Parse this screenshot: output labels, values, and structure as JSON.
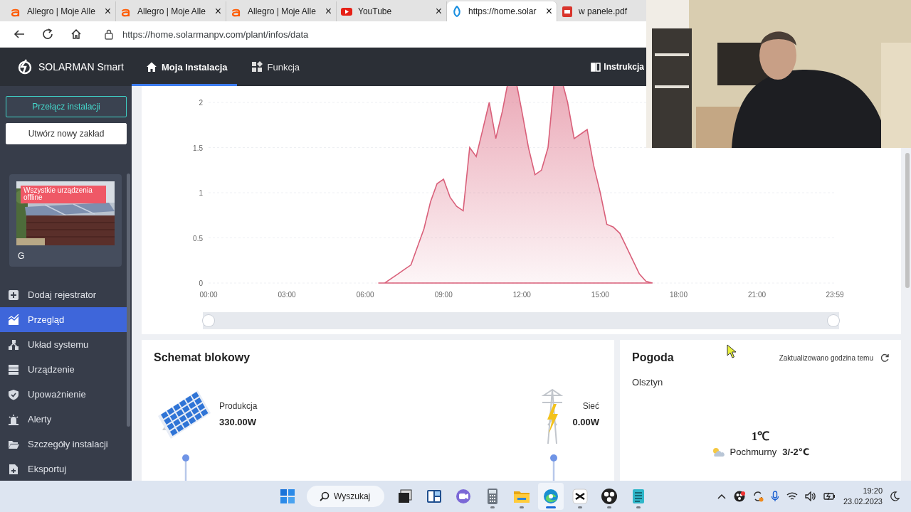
{
  "browser": {
    "tabs": [
      {
        "kind": "allegro",
        "title": "Allegro | Moje Alle",
        "close": "×",
        "selected": false
      },
      {
        "kind": "allegro",
        "title": "Allegro | Moje Alle",
        "close": "×",
        "selected": false
      },
      {
        "kind": "allegro",
        "title": "Allegro | Moje Alle",
        "close": "×",
        "selected": false
      },
      {
        "kind": "youtube",
        "title": "YouTube",
        "close": "×",
        "selected": false
      },
      {
        "kind": "solarman",
        "title": "https://home.solar",
        "close": "×",
        "selected": true
      },
      {
        "kind": "pdf",
        "title": "w panele.pdf",
        "selected": false
      }
    ],
    "url": "https://home.solarmanpv.com/plant/infos/data"
  },
  "app": {
    "logo_text": "SOLARMAN Smart",
    "nav": [
      {
        "kind": "home",
        "label": "Moja Instalacja",
        "selected": true
      },
      {
        "kind": "grid",
        "label": "Funkcja",
        "selected": false
      }
    ],
    "header_link": "Instrukcja"
  },
  "sidebar": {
    "buttons": [
      {
        "kind": "outline",
        "label": "Przełącz instalacji"
      },
      {
        "kind": "solid",
        "label": "Utwórz nowy zakład"
      }
    ],
    "plant": {
      "badge": "Wszystkie urządzenia offline",
      "name": "G"
    },
    "items": [
      {
        "kind": "plus",
        "label": "Dodaj rejestrator",
        "selected": false
      },
      {
        "kind": "chart",
        "label": "Przegląd",
        "selected": true
      },
      {
        "kind": "network",
        "label": "Układ systemu",
        "selected": false
      },
      {
        "kind": "server",
        "label": "Urządzenie",
        "selected": false
      },
      {
        "kind": "shield",
        "label": "Upoważnienie",
        "selected": false
      },
      {
        "kind": "alarm",
        "label": "Alerty",
        "selected": false
      },
      {
        "kind": "folder",
        "label": "Szczegóły instalacji",
        "selected": false
      },
      {
        "kind": "file",
        "label": "Eksportuj",
        "selected": false
      }
    ]
  },
  "power_chart": {
    "chart_data": {
      "type": "area",
      "xlim": [
        0,
        23.983
      ],
      "ylim": [
        0,
        2
      ],
      "grid": true,
      "x": [
        6.5,
        6.75,
        7,
        7.25,
        7.5,
        7.75,
        8,
        8.25,
        8.5,
        8.75,
        9,
        9.25,
        9.5,
        9.75,
        10,
        10.25,
        10.5,
        10.75,
        11,
        11.25,
        11.5,
        11.75,
        12,
        12.25,
        12.5,
        12.75,
        13,
        13.25,
        13.5,
        13.75,
        14,
        14.25,
        14.5,
        14.75,
        15,
        15.25,
        15.5,
        15.75,
        16,
        16.25,
        16.5,
        16.75,
        17
      ],
      "series": [
        {
          "color": "#d9607a",
          "values": [
            0,
            0,
            0.05,
            0.1,
            0.15,
            0.2,
            0.4,
            0.6,
            0.9,
            1.1,
            1.15,
            0.95,
            0.85,
            0.8,
            1.5,
            1.4,
            1.7,
            2.0,
            1.6,
            1.9,
            null,
            null,
            1.9,
            1.5,
            1.2,
            1.25,
            1.5,
            null,
            null,
            2.0,
            1.6,
            1.65,
            1.7,
            1.3,
            1.0,
            0.65,
            0.62,
            0.55,
            0.4,
            0.25,
            0.1,
            0.02,
            0
          ]
        }
      ],
      "yticks": [
        0,
        0.5,
        1,
        1.5,
        2
      ],
      "xticks": [
        {
          "value": 0,
          "label": "00:00"
        },
        {
          "value": 3,
          "label": "03:00"
        },
        {
          "value": 6,
          "label": "06:00"
        },
        {
          "value": 9,
          "label": "09:00"
        },
        {
          "value": 12,
          "label": "12:00"
        },
        {
          "value": 15,
          "label": "15:00"
        },
        {
          "value": 18,
          "label": "18:00"
        },
        {
          "value": 21,
          "label": "21:00"
        },
        {
          "value": 23.983,
          "label": "23:59"
        }
      ]
    },
    "zoom_handles": [
      {
        "level": 0
      },
      {
        "level": 1
      }
    ]
  },
  "block_diagram": {
    "title": "Schemat blokowy",
    "nodes": [
      {
        "kind": "solar",
        "label": "Produkcja",
        "value": "330.00W"
      },
      {
        "kind": "grid",
        "label": "Sieć",
        "value": "0.00W"
      }
    ]
  },
  "weather": {
    "title": "Pogoda",
    "updated": "Zaktualizowano godzina temu",
    "city": "Olsztyn",
    "temperature": "1℃",
    "condition": "Pochmurny",
    "range": "3/-2℃"
  },
  "taskbar": {
    "search": "Wyszukaj",
    "apps": [
      {
        "kind": "start",
        "running": false,
        "selected": false
      },
      {
        "kind": "taskview",
        "running": false,
        "selected": false
      },
      {
        "kind": "widgets",
        "running": false,
        "selected": false
      },
      {
        "kind": "chat",
        "running": false,
        "selected": false
      },
      {
        "kind": "calculator",
        "running": true,
        "selected": false
      },
      {
        "kind": "explorer",
        "running": true,
        "selected": false
      },
      {
        "kind": "edge",
        "running": true,
        "selected": true
      },
      {
        "kind": "capcut",
        "running": true,
        "selected": false
      },
      {
        "kind": "obs",
        "running": true,
        "selected": false
      },
      {
        "kind": "notepad",
        "running": true,
        "selected": false
      }
    ],
    "time": "19:20",
    "date": "23.02.2023"
  }
}
